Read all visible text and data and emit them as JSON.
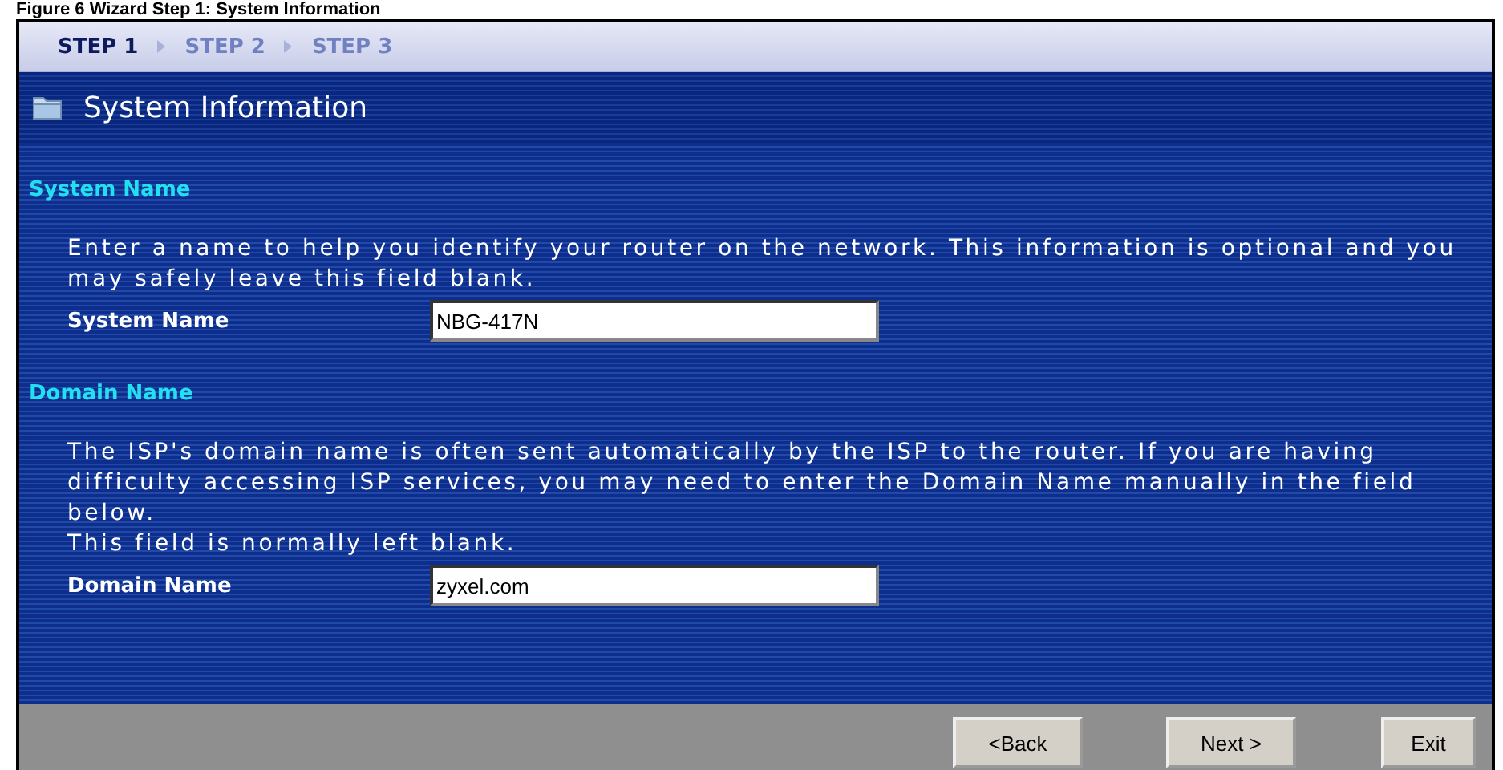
{
  "caption": "Figure 6   Wizard Step 1: System Information",
  "steps": [
    {
      "label": "STEP 1",
      "selected": true
    },
    {
      "label": "STEP 2",
      "selected": false
    },
    {
      "label": "STEP 3",
      "selected": false
    }
  ],
  "title": "System Information",
  "sections": [
    {
      "heading": "System Name",
      "paragraphs": [
        "Enter a name to help you identify your router on the network. This information is optional and you may safely leave this field blank."
      ],
      "field": {
        "label": "System Name",
        "value": "NBG-417N"
      }
    },
    {
      "heading": "Domain Name",
      "paragraphs": [
        "The ISP's domain name is often sent automatically by the ISP to the router. If you are having difficulty accessing ISP services, you may need to enter the Domain Name manually in the field below.",
        "This field is normally left blank."
      ],
      "field": {
        "label": "Domain Name",
        "value": "zyxel.com"
      }
    }
  ],
  "buttons": [
    "<Back",
    "Next >",
    "Exit"
  ]
}
